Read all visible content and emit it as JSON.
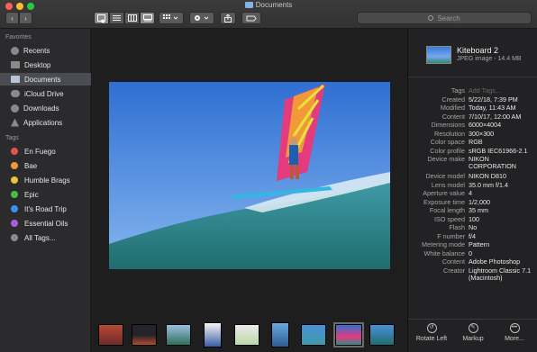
{
  "window": {
    "title": "Documents"
  },
  "toolbar": {
    "back_icon": "chevron-left-icon",
    "forward_icon": "chevron-right-icon",
    "search_placeholder": "Search",
    "views": [
      "icon-view",
      "list-view",
      "column-view",
      "gallery-view"
    ],
    "active_view": "gallery-view"
  },
  "sidebar": {
    "favorites_label": "Favorites",
    "favorites": [
      {
        "label": "Recents",
        "icon": "clock-icon"
      },
      {
        "label": "Desktop",
        "icon": "desktop-icon"
      },
      {
        "label": "Documents",
        "icon": "folder-icon",
        "selected": true
      },
      {
        "label": "iCloud Drive",
        "icon": "cloud-icon"
      },
      {
        "label": "Downloads",
        "icon": "download-icon"
      },
      {
        "label": "Applications",
        "icon": "applications-icon"
      }
    ],
    "tags_label": "Tags",
    "tags": [
      {
        "label": "En Fuego",
        "color": "#e5534b"
      },
      {
        "label": "Bae",
        "color": "#f0973a"
      },
      {
        "label": "Humble Brags",
        "color": "#e9c33c"
      },
      {
        "label": "Epic",
        "color": "#4cbb4b"
      },
      {
        "label": "It's Road Trip",
        "color": "#3d8ef0"
      },
      {
        "label": "Essential Oils",
        "color": "#a85ed6"
      },
      {
        "label": "All Tags...",
        "color": "#8a8a8a"
      }
    ]
  },
  "inspector": {
    "file_name": "Kiteboard 2",
    "file_kind": "JPEG image - 14.4 MB",
    "metadata": [
      {
        "key": "Tags",
        "value": "Add Tags...",
        "placeholder": true
      },
      {
        "key": "Created",
        "value": "5/22/18, 7:39 PM"
      },
      {
        "key": "Modified",
        "value": "Today, 11:43 AM"
      },
      {
        "key": "Content",
        "value": "7/10/17, 12:00 AM"
      },
      {
        "key": "Dimensions",
        "value": "6000×4004"
      },
      {
        "key": "Resolution",
        "value": "300×300"
      },
      {
        "key": "Color space",
        "value": "RGB"
      },
      {
        "key": "Color profile",
        "value": "sRGB IEC61966-2.1"
      },
      {
        "key": "Device make",
        "value": "NIKON CORPORATION"
      },
      {
        "key": "Device model",
        "value": "NIKON D810"
      },
      {
        "key": "Lens model",
        "value": "35.0 mm f/1.4"
      },
      {
        "key": "Aperture value",
        "value": "4"
      },
      {
        "key": "Exposure time",
        "value": "1/2,000"
      },
      {
        "key": "Focal length",
        "value": "35 mm"
      },
      {
        "key": "ISO speed",
        "value": "100"
      },
      {
        "key": "Flash",
        "value": "No"
      },
      {
        "key": "F number",
        "value": "f/4"
      },
      {
        "key": "Metering mode",
        "value": "Pattern"
      },
      {
        "key": "White balance",
        "value": "0"
      },
      {
        "key": "Content",
        "value": "Adobe Photoshop"
      },
      {
        "key": "Creator",
        "value": "Lightroom Classic 7.1 (Macintosh)"
      }
    ],
    "actions": [
      {
        "label": "Rotate Left",
        "icon": "rotate-left-icon"
      },
      {
        "label": "Markup",
        "icon": "markup-icon"
      },
      {
        "label": "More...",
        "icon": "more-icon"
      }
    ]
  },
  "filmstrip": {
    "selected_index": 7,
    "thumbnails": 10
  }
}
